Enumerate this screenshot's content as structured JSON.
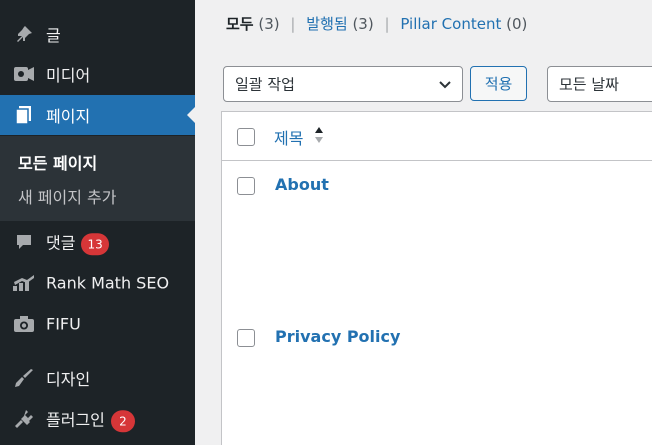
{
  "sidebar": {
    "items": [
      {
        "label": "글",
        "icon": "pin-icon"
      },
      {
        "label": "미디어",
        "icon": "media-icon"
      },
      {
        "label": "페이지",
        "icon": "pages-icon",
        "active": true
      },
      {
        "label": "댓글",
        "icon": "comment-icon",
        "badge": "13"
      },
      {
        "label": "Rank Math SEO",
        "icon": "rank-math-icon"
      },
      {
        "label": "FIFU",
        "icon": "camera-icon"
      },
      {
        "label": "디자인",
        "icon": "brush-icon"
      },
      {
        "label": "플러그인",
        "icon": "plugin-icon",
        "badge": "2"
      }
    ],
    "submenu": {
      "current": "모든 페이지",
      "add_new": "새 페이지 추가"
    }
  },
  "filters": {
    "all_label": "모두",
    "all_count": "(3)",
    "published_label": "발행됨",
    "published_count": "(3)",
    "pillar_label": "Pillar Content",
    "pillar_count": "(0)",
    "separator": "|"
  },
  "toolbar": {
    "bulk_action": "일괄 작업",
    "apply_label": "적용",
    "date_filter": "모든 날짜"
  },
  "table": {
    "column_title": "제목",
    "rows": [
      {
        "title": "About"
      },
      {
        "title": "Privacy Policy"
      }
    ]
  },
  "colors": {
    "sidebar_bg": "#1d2327",
    "accent": "#2271b1",
    "badge": "#d63638"
  }
}
